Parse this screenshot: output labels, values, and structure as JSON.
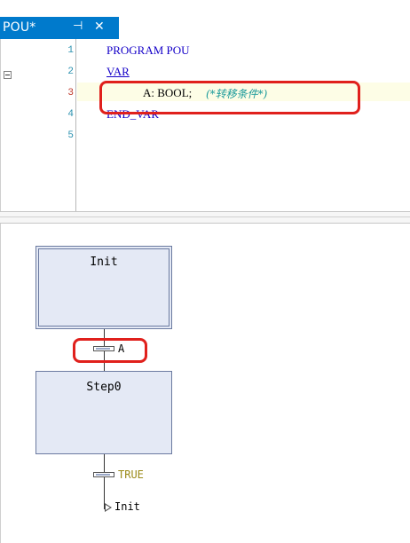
{
  "tab": {
    "title": "POU*",
    "pin_glyph": "⊣",
    "close_glyph": "✕"
  },
  "editor": {
    "line_numbers": [
      "1",
      "2",
      "3",
      "4",
      "5"
    ],
    "lines": {
      "l1": "PROGRAM POU",
      "l2": "VAR",
      "l3_decl": "A: BOOL;",
      "l3_comment": "(*转移条件*)",
      "l4": "END_VAR"
    }
  },
  "sfc": {
    "init_step": "Init",
    "step0": "Step0",
    "transition1": "A",
    "transition2": "TRUE",
    "jump_target": "Init"
  },
  "colors": {
    "tab_bg": "#007acc",
    "keyword": "#1400c8",
    "comment": "#1d9b9b",
    "highlight_box": "#e0201c",
    "step_fill": "#e4e9f5",
    "true_color": "#9b8a18"
  }
}
